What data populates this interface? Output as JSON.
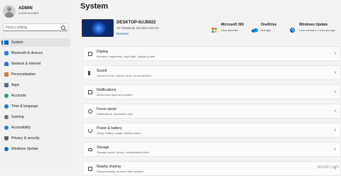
{
  "user": {
    "name": "ADMIN",
    "account": "Local Account"
  },
  "search": {
    "placeholder": "Find a setting"
  },
  "sidebar": {
    "items": [
      {
        "label": "System",
        "active": true,
        "color": "#0067c0"
      },
      {
        "label": "Bluetooth & devices",
        "color": "#2e7de0"
      },
      {
        "label": "Network & internet",
        "color": "#2b6fd6"
      },
      {
        "label": "Personalisation",
        "color": "#d07a3a"
      },
      {
        "label": "Apps",
        "color": "#5a6a8a"
      },
      {
        "label": "Accounts",
        "color": "#2aa36b"
      },
      {
        "label": "Time & language",
        "color": "#1f78d1"
      },
      {
        "label": "Gaming",
        "color": "#6b6b6b"
      },
      {
        "label": "Accessibility",
        "color": "#2d7fd9"
      },
      {
        "label": "Privacy & security",
        "color": "#5a5a5a"
      },
      {
        "label": "Windows Update",
        "color": "#0a6fd0"
      }
    ]
  },
  "page": {
    "title": "System"
  },
  "device": {
    "name": "DESKTOP-6UJ5922",
    "model": "HP EliteBook Revolve 810 G1",
    "rename": "Rename"
  },
  "quick": [
    {
      "title": "Microsoft 365",
      "subtitle": "View benefits",
      "icon": "microsoft-365-icon"
    },
    {
      "title": "OneDrive",
      "subtitle": "Manage",
      "icon": "onedrive-icon"
    },
    {
      "title": "Windows Update",
      "subtitle": "Last checked: 4 minutes ago",
      "icon": "windows-update-icon"
    }
  ],
  "settings": [
    {
      "title": "Display",
      "subtitle": "Monitors, brightness, night light, display profile",
      "icon": "display-icon"
    },
    {
      "title": "Sound",
      "subtitle": "Volume levels, output, input, sound devices",
      "icon": "sound-icon"
    },
    {
      "title": "Notifications",
      "subtitle": "Alerts from apps and system",
      "icon": "notifications-icon"
    },
    {
      "title": "Focus assist",
      "subtitle": "Notifications, automatic rules",
      "icon": "focus-assist-icon"
    },
    {
      "title": "Power & battery",
      "subtitle": "Sleep, battery usage, battery saver",
      "icon": "power-icon"
    },
    {
      "title": "Storage",
      "subtitle": "Storage space, drives, configuration rules",
      "icon": "storage-icon"
    },
    {
      "title": "Nearby sharing",
      "subtitle": "Discoverability, received files location",
      "icon": "nearby-sharing-icon"
    }
  ],
  "watermark": "wsxdn.com"
}
